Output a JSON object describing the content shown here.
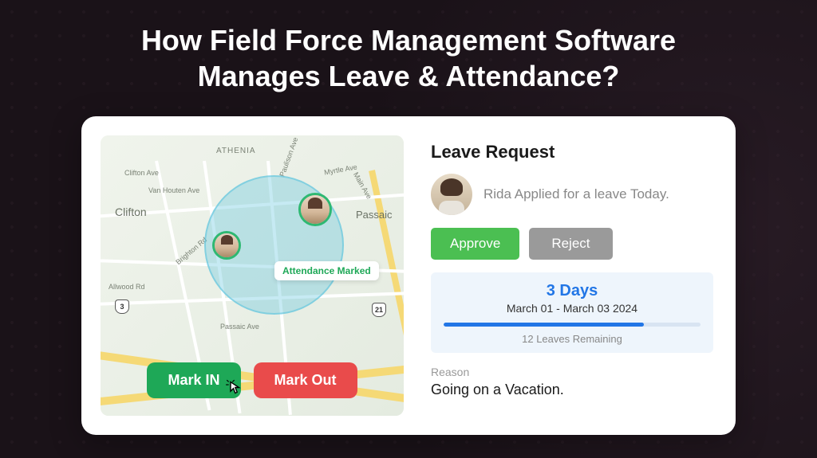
{
  "headline": "How Field Force Management Software\nManages Leave & Attendance?",
  "map": {
    "labels": {
      "athenia": "ATHENIA",
      "clifton": "Clifton",
      "passaic": "Passaic",
      "paulison": "Paulison Ave",
      "vanhouten": "Van Houten Ave",
      "myrtle": "Myrtle Ave",
      "main": "Main Ave",
      "cliftonave": "Clifton Ave",
      "allwood": "Allwood Rd",
      "brighton": "Brighton Rd",
      "passaicave": "Passaic Ave"
    },
    "routes": {
      "r3": "3",
      "r21": "21"
    },
    "status_chip": "Attendance Marked",
    "buttons": {
      "mark_in": "Mark IN",
      "mark_out": "Mark Out"
    }
  },
  "leave": {
    "title": "Leave Request",
    "request_text": "Rida Applied for a leave Today.",
    "approve_label": "Approve",
    "reject_label": "Reject",
    "days": "3 Days",
    "date_range": "March 01 - March 03 2024",
    "remaining": "12 Leaves Remaining",
    "progress_pct": 78,
    "reason_label": "Reason",
    "reason_text": "Going on a Vacation."
  },
  "colors": {
    "approve": "#4bbf52",
    "reject": "#9a9a9a",
    "mark_in": "#1ea857",
    "mark_out": "#e94b4b",
    "accent_blue": "#2276e6"
  }
}
